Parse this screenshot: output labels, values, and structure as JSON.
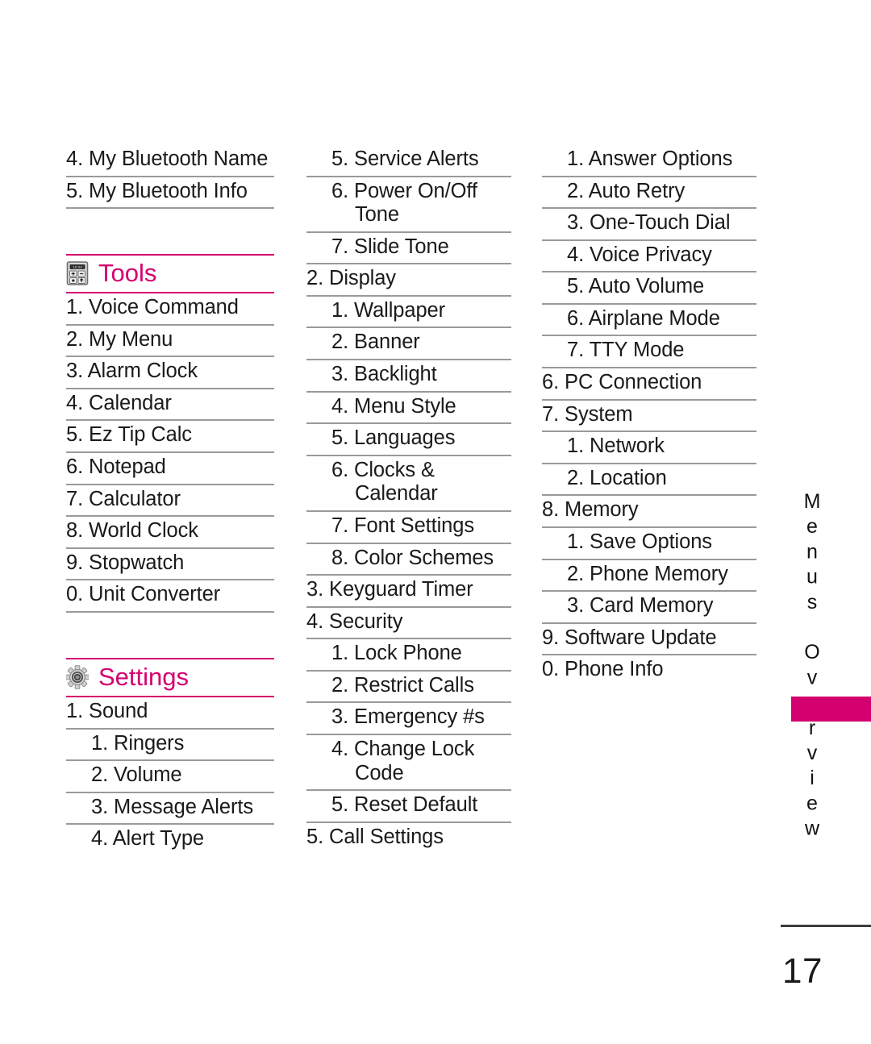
{
  "page": {
    "number": "17",
    "side_tab_label": "Menus Overview",
    "accent_color": "#d4006f",
    "rule_color": "#9a9a9a",
    "text_color": "#1a1a1a"
  },
  "columns": [
    {
      "id": "column-left",
      "blocks": [
        {
          "type": "list",
          "items": [
            {
              "label": "4. My Bluetooth Name",
              "level": 1,
              "wrap": true,
              "separator": true
            },
            {
              "label": "5. My Bluetooth Info",
              "level": 1,
              "wrap": false,
              "separator": true
            }
          ]
        },
        {
          "type": "gap"
        },
        {
          "type": "section",
          "title": "Tools",
          "icon": "calculator-icon",
          "items": [
            {
              "label": "1. Voice Command",
              "level": 1,
              "wrap": false,
              "separator": true
            },
            {
              "label": "2. My Menu",
              "level": 1,
              "wrap": false,
              "separator": true
            },
            {
              "label": "3. Alarm Clock",
              "level": 1,
              "wrap": false,
              "separator": true
            },
            {
              "label": "4. Calendar",
              "level": 1,
              "wrap": false,
              "separator": true
            },
            {
              "label": "5. Ez Tip Calc",
              "level": 1,
              "wrap": false,
              "separator": true
            },
            {
              "label": "6. Notepad",
              "level": 1,
              "wrap": false,
              "separator": true
            },
            {
              "label": "7. Calculator",
              "level": 1,
              "wrap": false,
              "separator": true
            },
            {
              "label": "8. World Clock",
              "level": 1,
              "wrap": false,
              "separator": true
            },
            {
              "label": "9. Stopwatch",
              "level": 1,
              "wrap": false,
              "separator": true
            },
            {
              "label": "0. Unit Converter",
              "level": 1,
              "wrap": false,
              "separator": true
            }
          ]
        },
        {
          "type": "gap"
        },
        {
          "type": "section",
          "title": "Settings",
          "icon": "gear-icon",
          "items": [
            {
              "label": "1. Sound",
              "level": 1,
              "wrap": false,
              "separator": true
            },
            {
              "label": "1. Ringers",
              "level": 2,
              "wrap": false,
              "separator": true
            },
            {
              "label": "2. Volume",
              "level": 2,
              "wrap": false,
              "separator": true
            },
            {
              "label": "3. Message Alerts",
              "level": 2,
              "wrap": false,
              "separator": true
            },
            {
              "label": "4. Alert Type",
              "level": 2,
              "wrap": false,
              "separator": false
            }
          ]
        }
      ]
    },
    {
      "id": "column-middle",
      "blocks": [
        {
          "type": "list",
          "items": [
            {
              "label": "5. Service Alerts",
              "level": 2,
              "wrap": false,
              "separator": true
            },
            {
              "label": "6. Power On/Off Tone",
              "level": 2,
              "wrap": true,
              "separator": true
            },
            {
              "label": "7. Slide Tone",
              "level": 2,
              "wrap": false,
              "separator": true
            },
            {
              "label": "2. Display",
              "level": 1,
              "wrap": false,
              "separator": true
            },
            {
              "label": "1. Wallpaper",
              "level": 2,
              "wrap": false,
              "separator": true
            },
            {
              "label": "2. Banner",
              "level": 2,
              "wrap": false,
              "separator": true
            },
            {
              "label": "3. Backlight",
              "level": 2,
              "wrap": false,
              "separator": true
            },
            {
              "label": "4. Menu Style",
              "level": 2,
              "wrap": false,
              "separator": true
            },
            {
              "label": "5. Languages",
              "level": 2,
              "wrap": false,
              "separator": true
            },
            {
              "label": "6. Clocks & Calendar",
              "level": 2,
              "wrap": true,
              "separator": true
            },
            {
              "label": "7. Font Settings",
              "level": 2,
              "wrap": false,
              "separator": true
            },
            {
              "label": "8. Color Schemes",
              "level": 2,
              "wrap": false,
              "separator": true
            },
            {
              "label": "3. Keyguard Timer",
              "level": 1,
              "wrap": false,
              "separator": true
            },
            {
              "label": "4. Security",
              "level": 1,
              "wrap": false,
              "separator": true
            },
            {
              "label": "1. Lock Phone",
              "level": 2,
              "wrap": false,
              "separator": true
            },
            {
              "label": "2. Restrict Calls",
              "level": 2,
              "wrap": false,
              "separator": true
            },
            {
              "label": "3. Emergency #s",
              "level": 2,
              "wrap": false,
              "separator": true
            },
            {
              "label": "4. Change Lock Code",
              "level": 2,
              "wrap": true,
              "separator": true
            },
            {
              "label": "5. Reset Default",
              "level": 2,
              "wrap": false,
              "separator": true
            },
            {
              "label": "5. Call Settings",
              "level": 1,
              "wrap": false,
              "separator": false
            }
          ]
        }
      ]
    },
    {
      "id": "column-right",
      "blocks": [
        {
          "type": "list",
          "items": [
            {
              "label": "1. Answer Options",
              "level": 2,
              "wrap": false,
              "separator": true
            },
            {
              "label": "2. Auto Retry",
              "level": 2,
              "wrap": false,
              "separator": true
            },
            {
              "label": "3. One-Touch Dial",
              "level": 2,
              "wrap": false,
              "separator": true
            },
            {
              "label": "4. Voice Privacy",
              "level": 2,
              "wrap": false,
              "separator": true
            },
            {
              "label": "5. Auto Volume",
              "level": 2,
              "wrap": false,
              "separator": true
            },
            {
              "label": "6. Airplane Mode",
              "level": 2,
              "wrap": false,
              "separator": true
            },
            {
              "label": "7. TTY Mode",
              "level": 2,
              "wrap": false,
              "separator": true
            },
            {
              "label": "6. PC Connection",
              "level": 1,
              "wrap": false,
              "separator": true
            },
            {
              "label": "7. System",
              "level": 1,
              "wrap": false,
              "separator": true
            },
            {
              "label": "1. Network",
              "level": 2,
              "wrap": false,
              "separator": true
            },
            {
              "label": "2. Location",
              "level": 2,
              "wrap": false,
              "separator": true
            },
            {
              "label": "8. Memory",
              "level": 1,
              "wrap": false,
              "separator": true
            },
            {
              "label": "1. Save Options",
              "level": 2,
              "wrap": false,
              "separator": true
            },
            {
              "label": "2. Phone Memory",
              "level": 2,
              "wrap": false,
              "separator": true
            },
            {
              "label": "3. Card Memory",
              "level": 2,
              "wrap": false,
              "separator": true
            },
            {
              "label": "9. Software Update",
              "level": 1,
              "wrap": false,
              "separator": true
            },
            {
              "label": "0. Phone Info",
              "level": 1,
              "wrap": false,
              "separator": false
            }
          ]
        }
      ]
    }
  ]
}
